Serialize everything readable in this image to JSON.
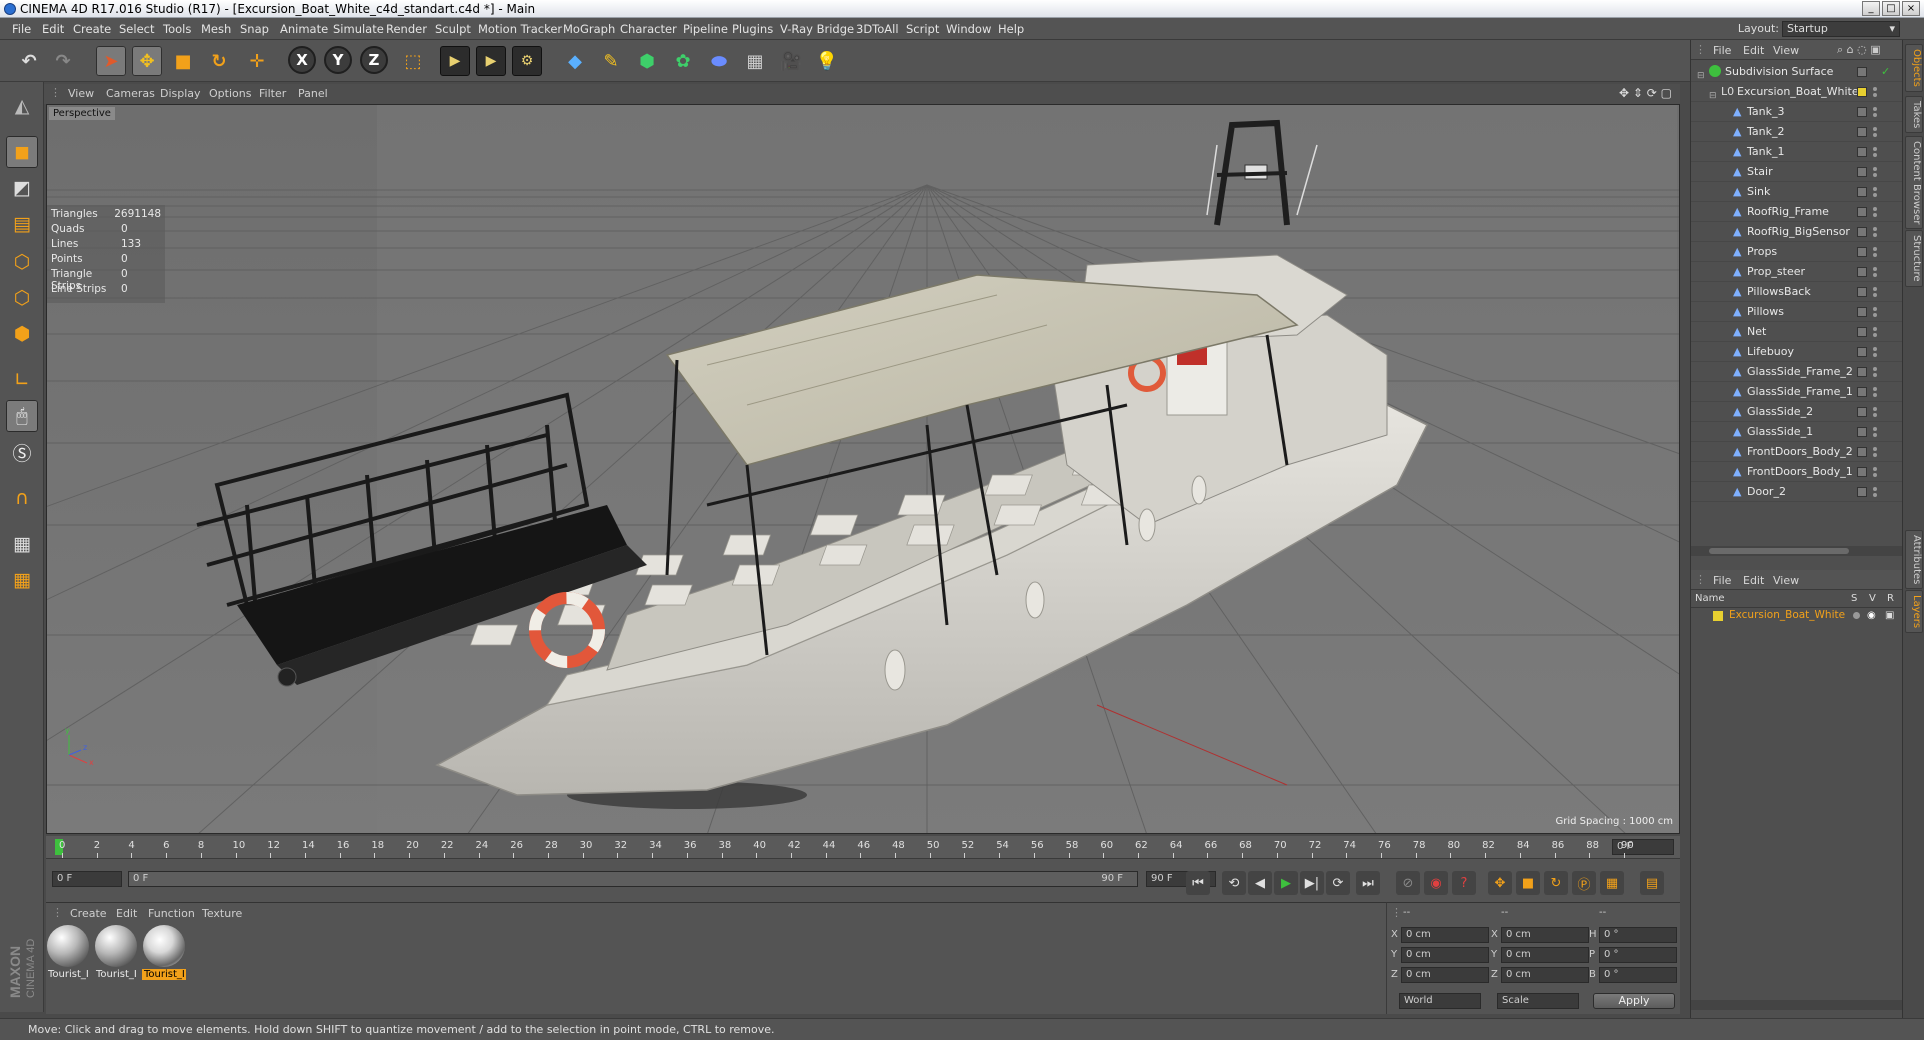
{
  "window": {
    "title": "CINEMA 4D R17.016 Studio (R17) - [Excursion_Boat_White_c4d_standart.c4d *] - Main"
  },
  "menu": [
    "File",
    "Edit",
    "Create",
    "Select",
    "Tools",
    "Mesh",
    "Snap",
    "Animate",
    "Simulate",
    "Render",
    "Sculpt",
    "Motion Tracker",
    "MoGraph",
    "Character",
    "Pipeline",
    "Plugins",
    "V-Ray Bridge",
    "3DToAll",
    "Script",
    "Window",
    "Help"
  ],
  "layout": {
    "label": "Layout:",
    "value": "Startup"
  },
  "toolbar": {
    "axis_x": "X",
    "axis_y": "Y",
    "axis_z": "Z"
  },
  "viewport": {
    "menu": [
      "View",
      "Cameras",
      "Display",
      "Options",
      "Filter",
      "Panel"
    ],
    "name": "Perspective",
    "grid_spacing": "Grid Spacing : 1000 cm",
    "stats": [
      {
        "k": "Triangles",
        "v": "2691148"
      },
      {
        "k": "Quads",
        "v": "0"
      },
      {
        "k": "Lines",
        "v": "133"
      },
      {
        "k": "Points",
        "v": "0"
      },
      {
        "k": "Triangle Strips",
        "v": "0"
      },
      {
        "k": "Line Strips",
        "v": "0"
      }
    ]
  },
  "timeline": {
    "ticks": [
      "0",
      "2",
      "4",
      "6",
      "8",
      "10",
      "12",
      "14",
      "16",
      "18",
      "20",
      "22",
      "24",
      "26",
      "28",
      "30",
      "32",
      "34",
      "36",
      "38",
      "40",
      "42",
      "44",
      "46",
      "48",
      "50",
      "52",
      "54",
      "56",
      "58",
      "60",
      "62",
      "64",
      "66",
      "68",
      "70",
      "72",
      "74",
      "76",
      "78",
      "80",
      "82",
      "84",
      "86",
      "88",
      "90"
    ],
    "current_frame": "0 F"
  },
  "anim": {
    "start": "0 F",
    "slider_start": "0 F",
    "slider_end": "90 F",
    "end": "90 F"
  },
  "materials": {
    "menu": [
      "Create",
      "Edit",
      "Function",
      "Texture"
    ],
    "items": [
      {
        "label": "Tourist_I",
        "selected": false
      },
      {
        "label": "Tourist_I",
        "selected": false
      },
      {
        "label": "Tourist_I",
        "selected": true
      }
    ]
  },
  "coords": {
    "header": [
      "--",
      "--",
      "--"
    ],
    "rows": [
      {
        "a": "X",
        "av": "0 cm",
        "b": "X",
        "bv": "0 cm",
        "c": "H",
        "cv": "0 °"
      },
      {
        "a": "Y",
        "av": "0 cm",
        "b": "Y",
        "bv": "0 cm",
        "c": "P",
        "cv": "0 °"
      },
      {
        "a": "Z",
        "av": "0 cm",
        "b": "Z",
        "bv": "0 cm",
        "c": "B",
        "cv": "0 °"
      }
    ],
    "mode1": "World",
    "mode2": "Scale",
    "apply": "Apply"
  },
  "status": "Move: Click and drag to move elements. Hold down SHIFT to quantize movement / add to the selection in point mode, CTRL to remove.",
  "objects_panel": {
    "menu": [
      "File",
      "Edit",
      "View"
    ],
    "root": "Subdivision Surface",
    "group": "Excursion_Boat_White",
    "children": [
      "Tank_3",
      "Tank_2",
      "Tank_1",
      "Stair",
      "Sink",
      "RoofRig_Frame",
      "RoofRig_BigSensor",
      "Props",
      "Prop_steer",
      "PillowsBack",
      "Pillows",
      "Net",
      "Lifebuoy",
      "GlassSide_Frame_2",
      "GlassSide_Frame_1",
      "GlassSide_2",
      "GlassSide_1",
      "FrontDoors_Body_2",
      "FrontDoors_Body_1",
      "Door_2"
    ]
  },
  "layers_panel": {
    "menu": [
      "File",
      "Edit",
      "View"
    ],
    "cols": {
      "name": "Name",
      "s": "S",
      "v": "V",
      "r": "R"
    },
    "row": "Excursion_Boat_White"
  },
  "side_tabs": [
    "Objects",
    "Takes",
    "Content Browser",
    "Structure"
  ],
  "side_tabs2": [
    "Attributes",
    "Layers"
  ],
  "colors": {
    "accent": "#f2a11a",
    "ui_bg": "#545454",
    "viewport_bg": "#737373"
  }
}
